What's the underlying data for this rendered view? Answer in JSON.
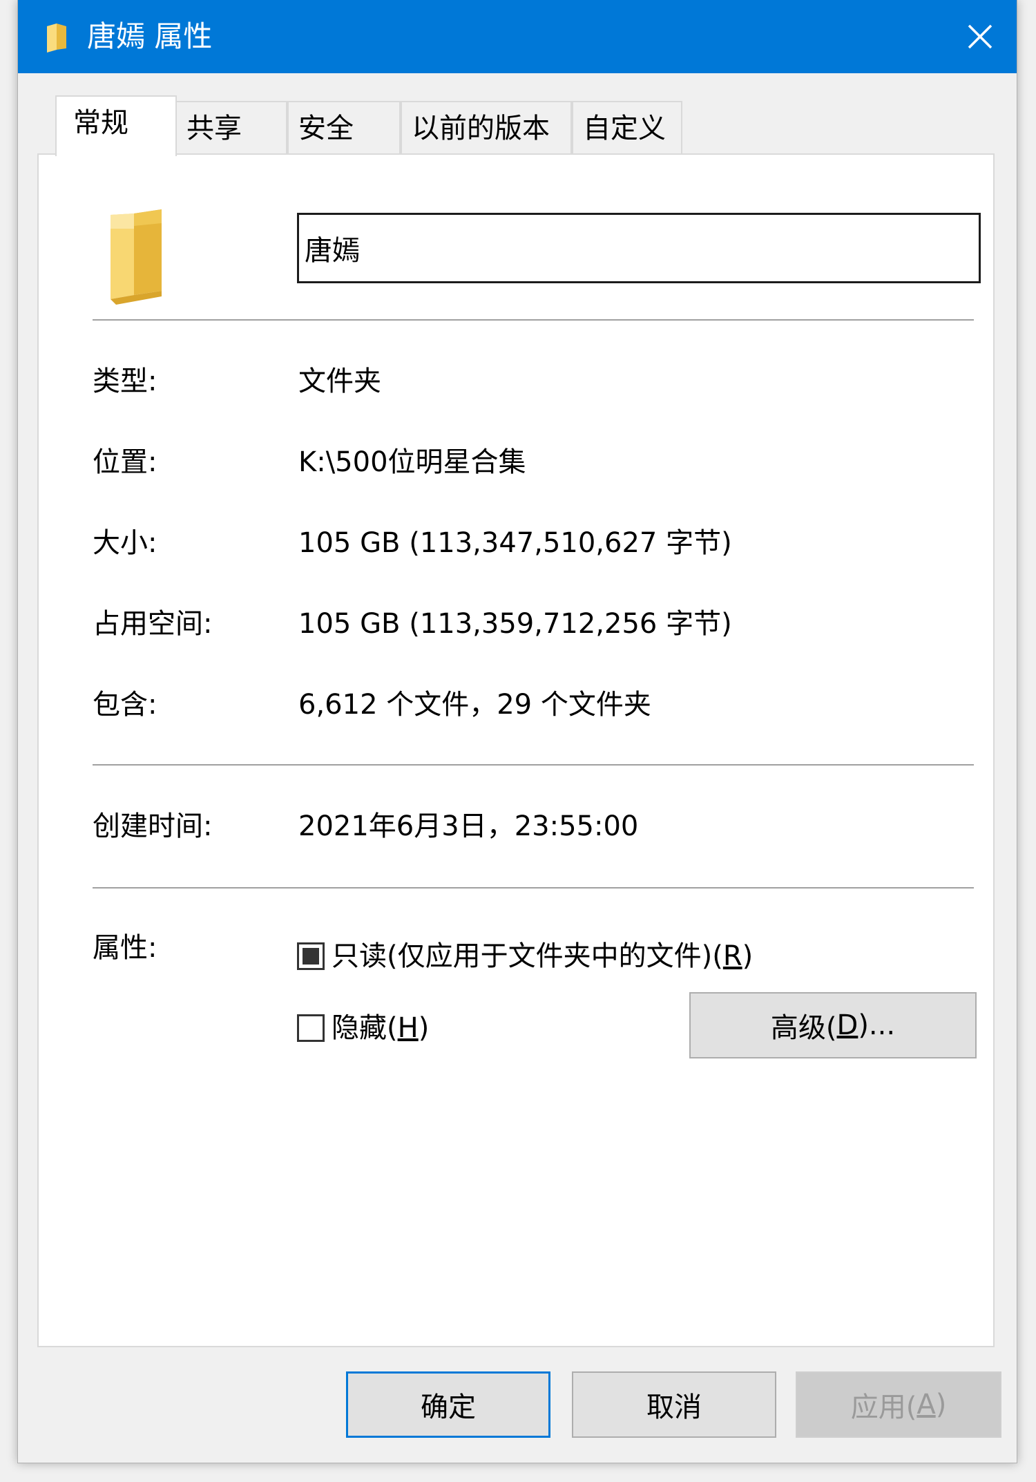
{
  "window": {
    "title": "唐嫣 属性",
    "titlebar_color": "#0078d7"
  },
  "tabs": [
    {
      "label": "常规",
      "active": true
    },
    {
      "label": "共享",
      "active": false
    },
    {
      "label": "安全",
      "active": false
    },
    {
      "label": "以前的版本",
      "active": false
    },
    {
      "label": "自定义",
      "active": false
    }
  ],
  "general": {
    "name_value": "唐嫣",
    "properties": [
      {
        "label": "类型:",
        "value": "文件夹"
      },
      {
        "label": "位置:",
        "value": "K:\\500位明星合集"
      },
      {
        "label": "大小:",
        "value": "105 GB (113,347,510,627 字节)"
      },
      {
        "label": "占用空间:",
        "value": "105 GB (113,359,712,256 字节)"
      },
      {
        "label": "包含:",
        "value": "6,612 个文件，29 个文件夹"
      }
    ],
    "created": {
      "label": "创建时间:",
      "value": "2021年6月3日，23:55:00"
    },
    "attributes": {
      "label": "属性:",
      "readonly_label": "只读(仅应用于文件夹中的文件)(",
      "readonly_key": "R",
      "readonly_state": "indeterminate",
      "hidden_label": "隐藏(",
      "hidden_key": "H",
      "hidden_checked": false,
      "advanced_label": "高级(",
      "advanced_key": "D",
      "advanced_suffix": ")..."
    }
  },
  "footer": {
    "ok_label": "确定",
    "cancel_label": "取消",
    "apply_label": "应用(",
    "apply_key": "A",
    "apply_enabled": false
  },
  "icons": {
    "title_icon": "folder-icon",
    "close_icon": "close-icon",
    "folder_color": "#f5cf60"
  }
}
